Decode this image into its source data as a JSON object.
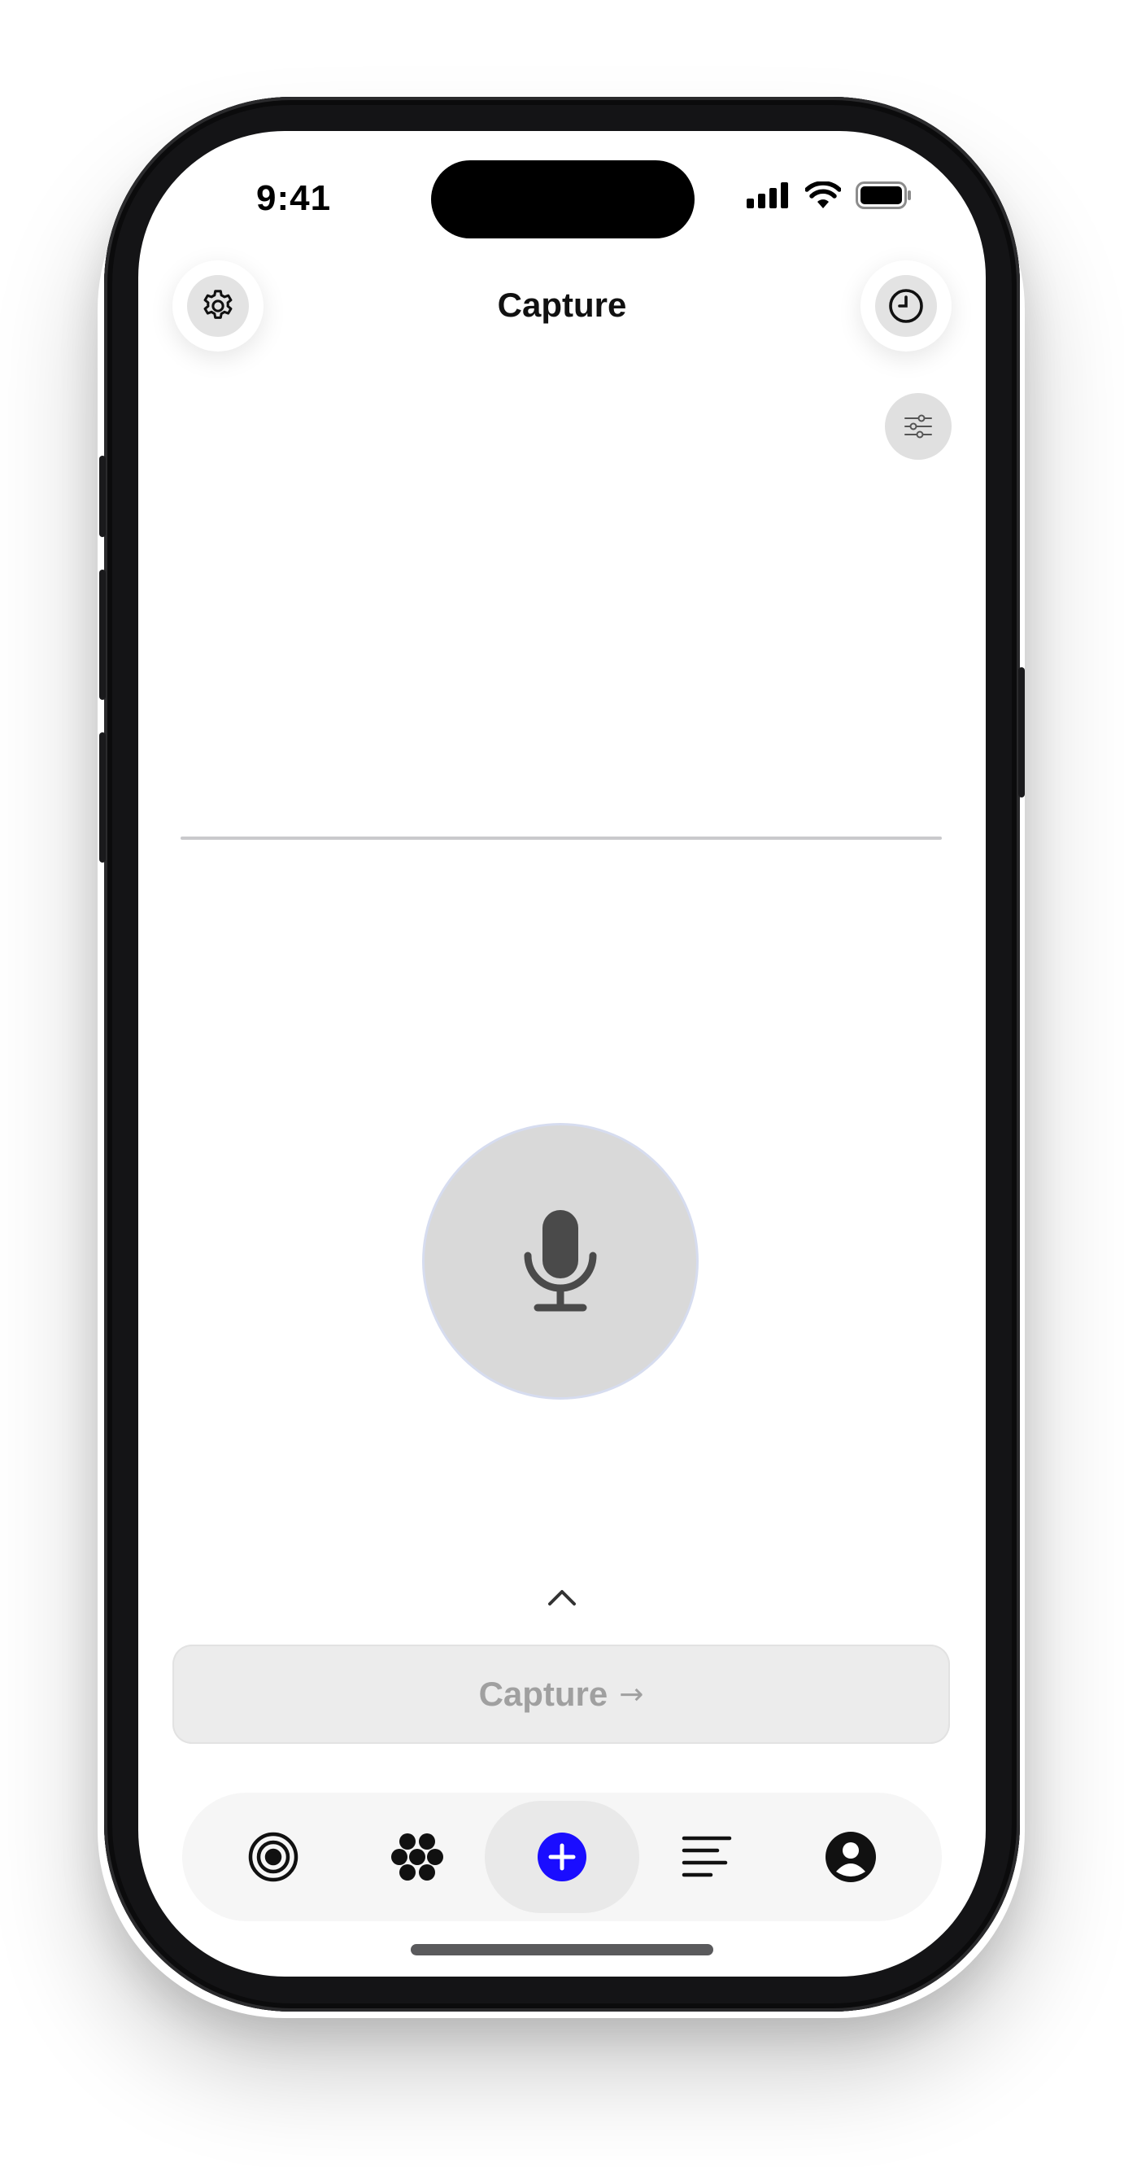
{
  "status_bar": {
    "time": "9:41",
    "icons": [
      "cellular-signal-icon",
      "wifi-icon",
      "battery-icon"
    ]
  },
  "header": {
    "title": "Capture",
    "left_button_icon": "gear-icon",
    "right_button_icon": "clock-icon",
    "filter_button_icon": "sliders-icon"
  },
  "recorder": {
    "mic_icon": "microphone-icon",
    "expand_icon": "chevron-up-icon"
  },
  "capture_button": {
    "label": "Capture",
    "arrow": "→",
    "enabled": false
  },
  "tab_bar": {
    "items": [
      {
        "id": "target",
        "icon": "target-icon"
      },
      {
        "id": "cluster",
        "icon": "cluster-dots-icon"
      },
      {
        "id": "add",
        "icon": "plus-circle-icon",
        "active": true
      },
      {
        "id": "list",
        "icon": "text-lines-icon"
      },
      {
        "id": "profile",
        "icon": "person-circle-icon"
      }
    ]
  },
  "colors": {
    "accent": "#1a0dff",
    "disabled_text": "#a0a0a0",
    "mic_fill": "#d9d9d9",
    "icon_dark": "#4a4a4a"
  }
}
